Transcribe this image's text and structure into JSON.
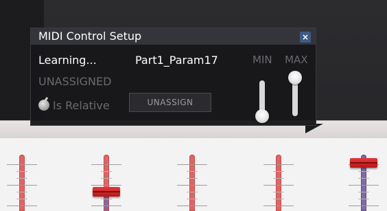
{
  "popup": {
    "title": "MIDI Control Setup",
    "close_label": "×",
    "status": "Learning...",
    "parameter": "Part1_Param17",
    "assignment": "UNASSIGNED",
    "relative_label": "Is Relative",
    "unassign_label": "UNASSIGN",
    "min_label": "MIN",
    "max_label": "MAX",
    "min_value": 0,
    "max_value": 1
  },
  "colors": {
    "accent_close": "#3d5b86",
    "fader_red": "#e06565",
    "fader_purple": "#7f6aa6",
    "cap_red": "#c42020"
  }
}
